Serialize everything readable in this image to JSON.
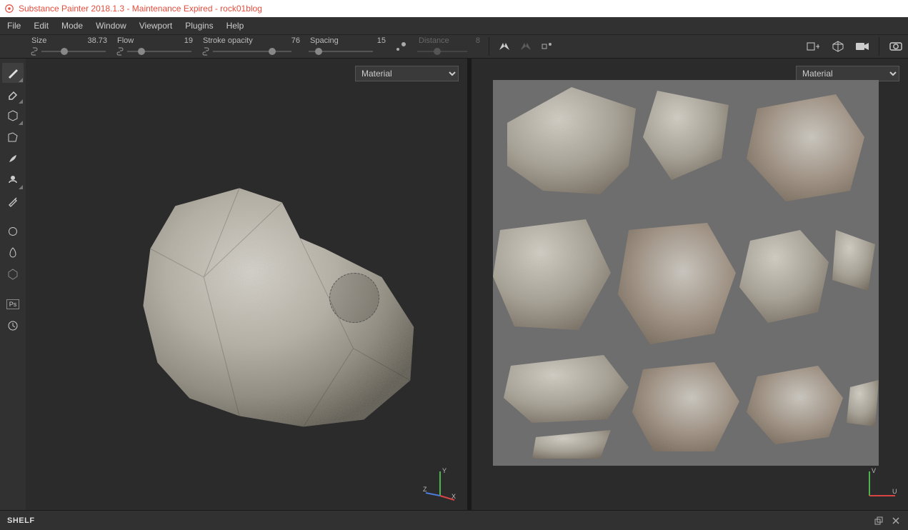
{
  "title": "Substance Painter 2018.1.3 - Maintenance Expired - rock01blog",
  "menu": [
    "File",
    "Edit",
    "Mode",
    "Window",
    "Viewport",
    "Plugins",
    "Help"
  ],
  "params": {
    "size": {
      "label": "Size",
      "value": "38.73",
      "thumb": 0.35
    },
    "flow": {
      "label": "Flow",
      "value": "19",
      "thumb": 0.22
    },
    "opacity": {
      "label": "Stroke opacity",
      "value": "76",
      "thumb": 0.75
    },
    "spacing": {
      "label": "Spacing",
      "value": "15",
      "thumb": 0.15
    },
    "distance": {
      "label": "Distance",
      "value": "8",
      "thumb": 0.4
    }
  },
  "viewport_select": "Material",
  "shelf": {
    "label": "SHELF"
  },
  "axes_3d": {
    "x": "X",
    "y": "Y",
    "z": "Z"
  },
  "axes_uv": {
    "u": "U",
    "v": "V"
  }
}
